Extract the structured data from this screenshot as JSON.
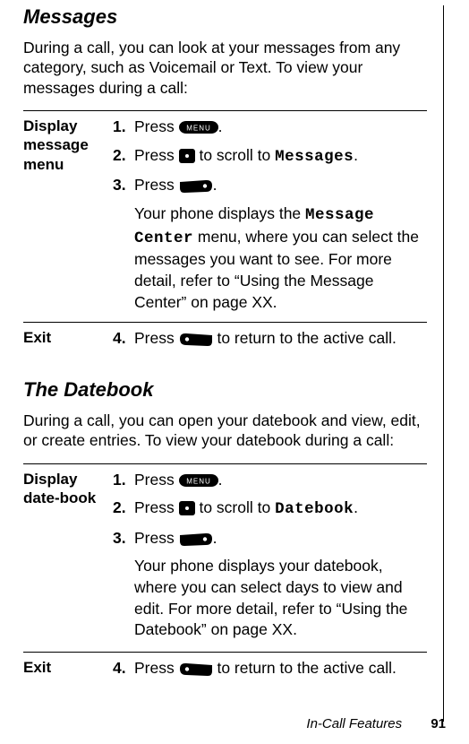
{
  "section1": {
    "heading": "Messages",
    "intro": "During a call, you can look at your messages from any category, such as Voicemail or Text. To view your messages during a call:",
    "rows": [
      {
        "label": "Display message menu",
        "steps": [
          {
            "n": "1.",
            "pre": "Press ",
            "icon": "menu",
            "post": "."
          },
          {
            "n": "2.",
            "pre": "Press ",
            "icon": "nav",
            "post": " to scroll to ",
            "mono": "Messages",
            "tail": "."
          },
          {
            "n": "3.",
            "pre": "Press ",
            "icon": "soft",
            "post": "."
          }
        ],
        "note_pre": "Your phone displays the ",
        "note_mono": "Message Center",
        "note_post": " menu, where you can select the messages you want to see. For more detail, refer to “Using the Message Center” on page XX."
      },
      {
        "label": "Exit",
        "steps": [
          {
            "n": "4.",
            "pre": "Press ",
            "icon": "back",
            "post": " to return to the active call."
          }
        ]
      }
    ]
  },
  "section2": {
    "heading": "The Datebook",
    "intro": "During a call, you can open your datebook and view, edit, or create entries. To view your datebook during a call:",
    "rows": [
      {
        "label": "Display date-book",
        "steps": [
          {
            "n": "1.",
            "pre": "Press ",
            "icon": "menu",
            "post": "."
          },
          {
            "n": "2.",
            "pre": "Press ",
            "icon": "nav",
            "post": " to scroll to ",
            "mono": "Datebook",
            "tail": "."
          },
          {
            "n": "3.",
            "pre": "Press ",
            "icon": "soft",
            "post": "."
          }
        ],
        "note_pre": "Your phone displays your datebook, where you can select days to view and edit. For more detail, refer to “Using the Datebook” on page XX.",
        "note_mono": "",
        "note_post": ""
      },
      {
        "label": "Exit",
        "steps": [
          {
            "n": "4.",
            "pre": "Press ",
            "icon": "back",
            "post": " to return to the active call."
          }
        ]
      }
    ]
  },
  "footer": {
    "chapter": "In-Call Features",
    "page": "91"
  }
}
